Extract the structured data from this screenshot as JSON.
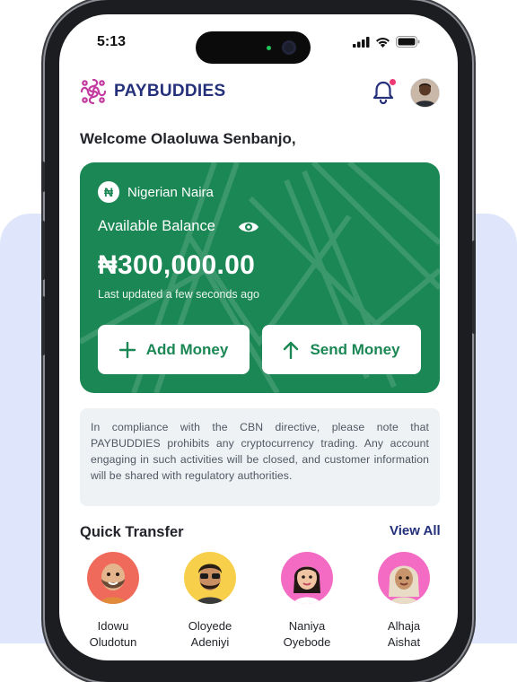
{
  "status_bar": {
    "time": "5:13"
  },
  "header": {
    "brand": "PAYBUDDIES",
    "logo_icon": "knot-logo-icon"
  },
  "welcome": "Welcome Olaoluwa Senbanjo,",
  "balance_card": {
    "currency_symbol": "₦",
    "currency": "Nigerian Naira",
    "label": "Available Balance",
    "amount": "₦300,000.00",
    "updated": "Last updated a few seconds ago",
    "add_money": "Add Money",
    "send_money": "Send Money",
    "card_color": "#1b8754"
  },
  "notice": "In compliance with the CBN directive, please note that PAYBUDDIES prohibits any cryptocurrency trading. Any account engaging in such activities will be closed, and customer information will be shared with regulatory authorities.",
  "quick_transfer": {
    "title": "Quick Transfer",
    "view_all": "View All",
    "contacts": [
      {
        "first": "Idowu",
        "second": "Oludotun",
        "color": "#f06a5c"
      },
      {
        "first": "Oloyede",
        "second": "Adeniyi",
        "color": "#f7cf4b"
      },
      {
        "first": "Naniya",
        "second": "Oyebode",
        "color": "#f46bc4"
      },
      {
        "first": "Alhaja",
        "second": "Aishat",
        "color": "#f46bc4"
      }
    ]
  },
  "colors": {
    "brand": "#25307a",
    "accent_pink": "#ec3a74",
    "background_panel": "#dfe6fb"
  }
}
